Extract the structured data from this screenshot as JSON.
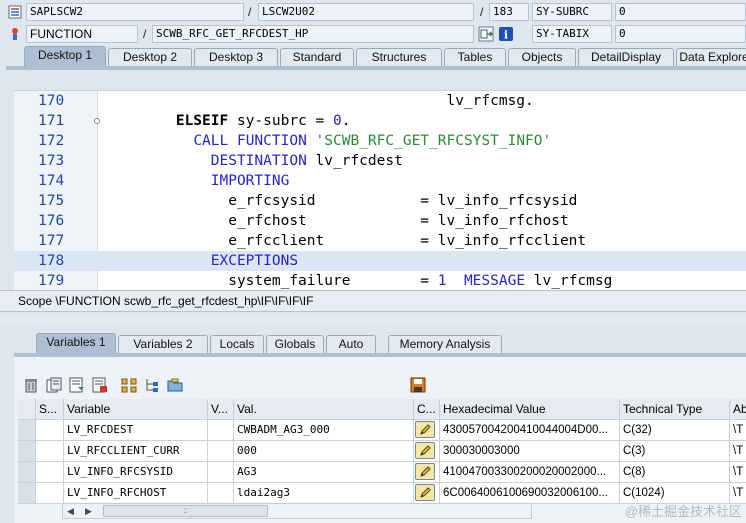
{
  "header": {
    "program": "SAPLSCW2",
    "include": "LSCW2U02",
    "line": "183",
    "subrc_label": "SY-SUBRC",
    "subrc_value": "0",
    "event_type": "FUNCTION",
    "event_name": "SCWB_RFC_GET_RFCDEST_HP",
    "tabix_label": "SY-TABIX",
    "tabix_value": "0"
  },
  "desktop_tabs": [
    "Desktop 1",
    "Desktop 2",
    "Desktop 3",
    "Standard",
    "Structures",
    "Tables",
    "Objects",
    "DetailDisplay",
    "Data Explorer"
  ],
  "active_desktop_tab": "Desktop 1",
  "code_lines": [
    {
      "num": "170",
      "parts": [
        {
          "t": "                                       lv_rfcmsg.",
          "c": ""
        }
      ]
    },
    {
      "num": "171",
      "parts": [
        {
          "t": "        ",
          "c": ""
        },
        {
          "t": "ELSEIF",
          "c": "kb"
        },
        {
          "t": " sy-subrc = ",
          "c": ""
        },
        {
          "t": "0",
          "c": "n"
        },
        {
          "t": ".",
          "c": ""
        }
      ]
    },
    {
      "num": "172",
      "parts": [
        {
          "t": "          ",
          "c": ""
        },
        {
          "t": "CALL FUNCTION",
          "c": "k"
        },
        {
          "t": " ",
          "c": ""
        },
        {
          "t": "'SCWB_RFC_GET_RFCSYST_INFO'",
          "c": "s"
        }
      ]
    },
    {
      "num": "173",
      "parts": [
        {
          "t": "            ",
          "c": ""
        },
        {
          "t": "DESTINATION",
          "c": "k"
        },
        {
          "t": " lv_rfcdest",
          "c": ""
        }
      ]
    },
    {
      "num": "174",
      "parts": [
        {
          "t": "            ",
          "c": ""
        },
        {
          "t": "IMPORTING",
          "c": "k"
        }
      ]
    },
    {
      "num": "175",
      "parts": [
        {
          "t": "              e_rfcsysid            = lv_info_rfcsysid",
          "c": ""
        }
      ]
    },
    {
      "num": "176",
      "parts": [
        {
          "t": "              e_rfchost             = lv_info_rfchost",
          "c": ""
        }
      ]
    },
    {
      "num": "177",
      "parts": [
        {
          "t": "              e_rfcclient           = lv_info_rfcclient",
          "c": ""
        }
      ]
    },
    {
      "num": "178",
      "parts": [
        {
          "t": "            ",
          "c": ""
        },
        {
          "t": "EXCEPTIONS",
          "c": "k"
        }
      ]
    },
    {
      "num": "179",
      "parts": [
        {
          "t": "              system_failure        = ",
          "c": ""
        },
        {
          "t": "1",
          "c": "n"
        },
        {
          "t": "  ",
          "c": ""
        },
        {
          "t": "MESSAGE",
          "c": "k"
        },
        {
          "t": " lv_rfcmsg",
          "c": ""
        }
      ]
    }
  ],
  "scope": "Scope \\FUNCTION scwb_rfc_get_rfcdest_hp\\IF\\IF\\IF\\IF",
  "variable_tabs": [
    "Variables 1",
    "Variables 2",
    "Locals",
    "Globals",
    "Auto",
    "Memory Analysis"
  ],
  "active_variable_tab": "Variables 1",
  "toolbar_icons": [
    "delete-icon",
    "delete-all-icon",
    "import-icon",
    "export-icon",
    "group-icon",
    "tree-icon",
    "folder-icon",
    "save-icon"
  ],
  "table": {
    "columns": [
      "S...",
      "Variable",
      "V...",
      "Val.",
      "C...",
      "Hexadecimal Value",
      "Technical Type",
      "Ab"
    ],
    "rows": [
      {
        "variable": "LV_RFCDEST",
        "value": "CWBADM_AG3_000",
        "hex": "430057004200410044004D00...",
        "type": "C(32)",
        "abs": "\\T"
      },
      {
        "variable": "LV_RFCCLIENT_CURR",
        "value": "000",
        "hex": "300030003000",
        "type": "C(3)",
        "abs": "\\T"
      },
      {
        "variable": "LV_INFO_RFCSYSID",
        "value": "AG3",
        "hex": "410047003300200020002000...",
        "type": "C(8)",
        "abs": "\\T"
      },
      {
        "variable": "LV_INFO_RFCHOST",
        "value": "ldai2ag3",
        "hex": "6C0064006100690032006100...",
        "type": "C(1024)",
        "abs": "\\T"
      }
    ]
  },
  "scroll_thumb_label": "::",
  "watermark": "@稀土掘金技术社区"
}
